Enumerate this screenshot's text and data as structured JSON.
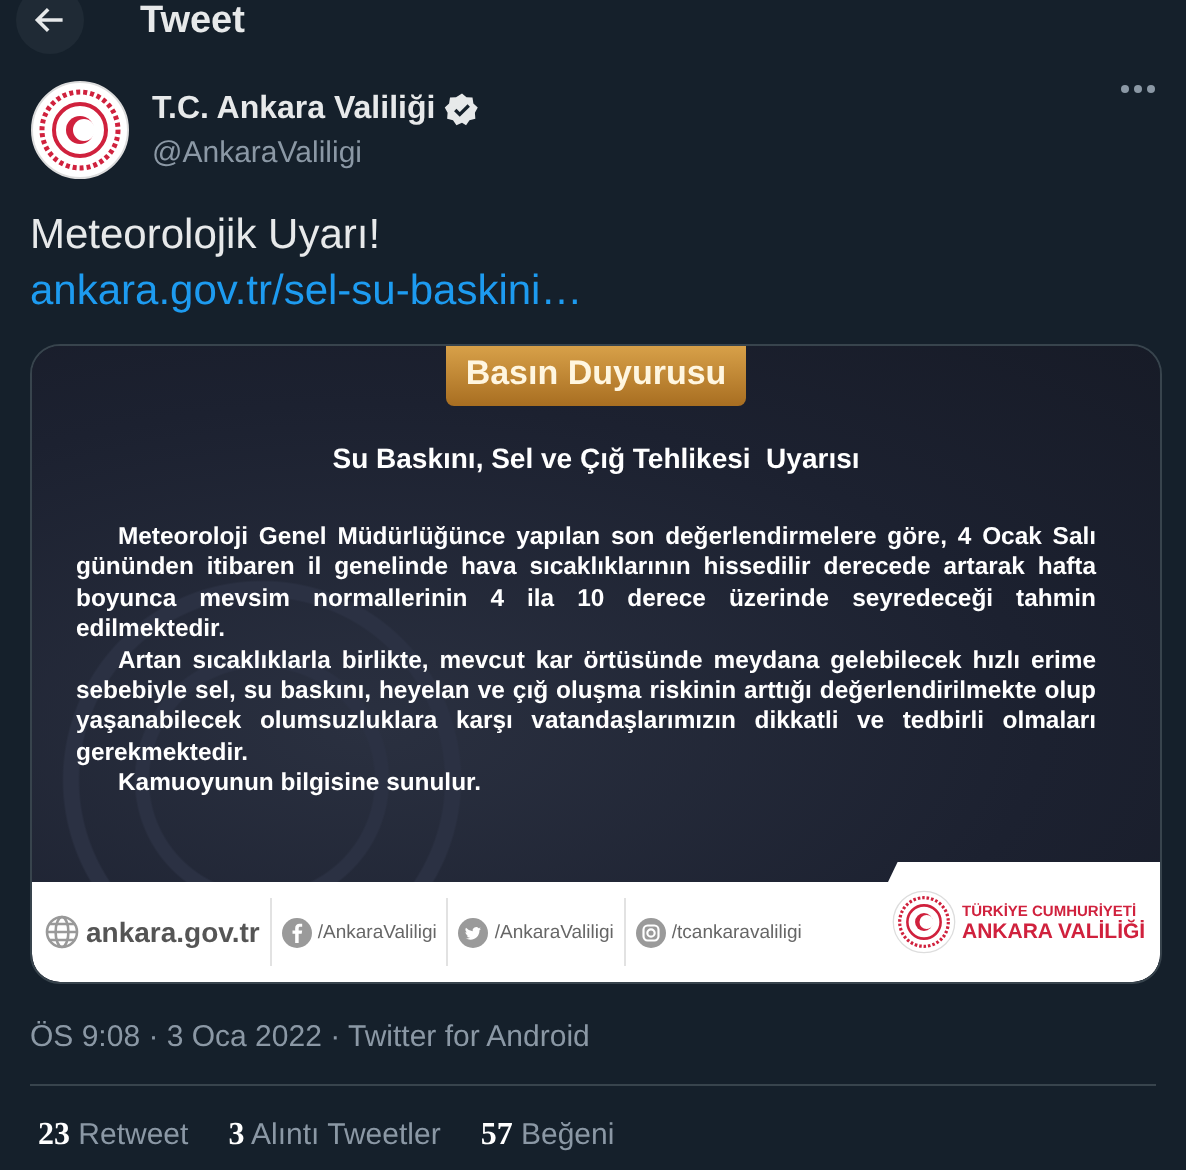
{
  "header": {
    "title": "Tweet"
  },
  "author": {
    "name": "T.C. Ankara Valiliği",
    "handle": "@AnkaraValiligi",
    "verified": true
  },
  "tweet": {
    "text": "Meteorolojik Uyarı!",
    "link": "ankara.gov.tr/sel-su-baskini…"
  },
  "attachment": {
    "badge": "Basın Duyurusu",
    "title": "Su Baskını, Sel ve Çığ Tehlikesi  Uyarısı",
    "paragraphs": [
      "Meteoroloji Genel Müdürlüğünce yapılan son değerlendirmelere göre, 4 Ocak Salı gününden itibaren il genelinde hava sıcaklıklarının hissedilir derecede artarak hafta boyunca mevsim normallerinin 4 ila 10 derece üzerinde seyredeceği tahmin edilmektedir.",
      "Artan sıcaklıklarla birlikte, mevcut kar örtüsünde meydana gelebilecek hızlı erime sebebiyle sel, su baskını, heyelan ve çığ oluşma riskinin arttığı değerlendirilmekte olup yaşanabilecek olumsuzluklara karşı vatandaşlarımızın dikkatli ve tedbirli olmaları gerekmektedir.",
      "Kamuoyunun bilgisine sunulur."
    ],
    "footer": {
      "website": "ankara.gov.tr",
      "socials": [
        {
          "kind": "facebook",
          "handle": "/AnkaraValiligi"
        },
        {
          "kind": "twitter",
          "handle": "/AnkaraValiligi"
        },
        {
          "kind": "instagram",
          "handle": "/tcankaravaliligi"
        }
      ],
      "org_line_1": "TÜRKİYE CUMHURİYETİ",
      "org_line_2": "ANKARA VALİLİĞİ"
    }
  },
  "meta": "ÖS 9:08 · 3 Oca 2022 · Twitter for Android",
  "stats": [
    {
      "count": "23",
      "label": "Retweet"
    },
    {
      "count": "3",
      "label": "Alıntı Tweetler"
    },
    {
      "count": "57",
      "label": "Beğeni"
    }
  ]
}
